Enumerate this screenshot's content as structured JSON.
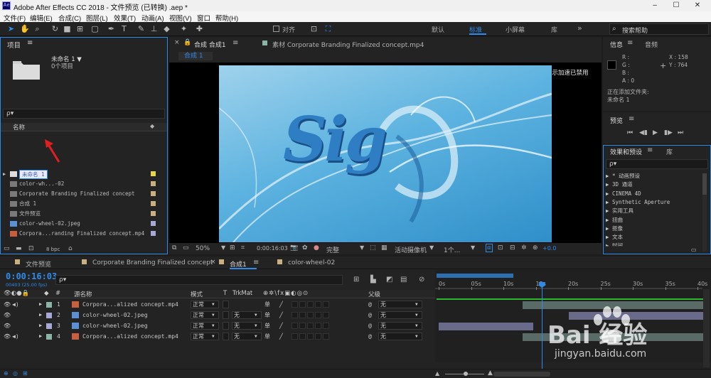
{
  "titlebar": {
    "app_icon": "Ae",
    "title": "Adobe After Effects CC 2018 - 文件预览 (已转换) .aep *",
    "minimize": "–",
    "maximize": "☐",
    "close": "✕"
  },
  "menu": [
    "文件(F)",
    "编辑(E)",
    "合成(C)",
    "图层(L)",
    "效果(T)",
    "动画(A)",
    "视图(V)",
    "窗口",
    "帮助(H)"
  ],
  "toolbar": {
    "snap_label": "对齐",
    "workspaces": [
      "默认",
      "标准",
      "小屏幕",
      "库"
    ],
    "active_workspace": "标准",
    "more": "»",
    "search_help": "搜索帮助"
  },
  "project": {
    "title": "项目",
    "comp_name": "未命名 1 ▼",
    "comp_count": "0个项目",
    "search_placeholder": "ρ▾",
    "col_name": "名称",
    "items": [
      {
        "name": "未命名 1",
        "type": "folder",
        "label_color": "#e4d64a"
      },
      {
        "name": "color-wh...-02",
        "type": "comp",
        "label_color": "#c8b080"
      },
      {
        "name": "Corporate Branding  Finalized concept",
        "type": "comp",
        "label_color": "#c8b080"
      },
      {
        "name": "合成 1",
        "type": "comp",
        "label_color": "#c8b080"
      },
      {
        "name": "文件预览",
        "type": "comp",
        "label_color": "#c8b080"
      },
      {
        "name": "color-wheel-02.jpeg",
        "type": "image",
        "label_color": "#a8a8d8"
      },
      {
        "name": "Corpora...randing  Finalized concept.mp4",
        "type": "video",
        "label_color": "#a8a8d8"
      }
    ],
    "bpc": "8 bpc"
  },
  "composition": {
    "tab_label": "合成 合成1",
    "footage_label": "素材 Corporate Branding  Finalized concept.mp4",
    "sub_tab": "合成 1",
    "accel_notice": "显示加速已禁用",
    "preview_text": "Sig",
    "zoom": "50%",
    "timecode": "0:00:16:03",
    "resolution": "完整",
    "camera": "活动摄像机",
    "views": "1个...",
    "exposure": "+0.0"
  },
  "info": {
    "tab_info": "信息",
    "tab_audio": "音频",
    "r": "R :",
    "g": "G :",
    "b": "B :",
    "a": "A : 0",
    "x": "X : 158",
    "y": "Y : 764",
    "status_line1": "正在添加文件夹:",
    "status_line2": "未命名 1"
  },
  "preview": {
    "title": "预览"
  },
  "effects": {
    "tab_effects": "效果和预设",
    "tab_library": "库",
    "search_placeholder": "ρ▾",
    "items": [
      "▶ * 动画预设",
      "▶ 3D 通道",
      "▶ CINEMA 4D",
      "▶ Synthetic Aperture",
      "▶ 实用工具",
      "▶ 扭曲",
      "▶ 抠像",
      "▶ 文本",
      "▶ 时间"
    ]
  },
  "timeline": {
    "tabs": [
      "文件预览",
      "Corporate Branding  Finalized concept",
      "合成1",
      "color-wheel-02"
    ],
    "active_tab": "合成1",
    "timecode": "0:00:16:03",
    "frames": "00403 (25.00 fps)",
    "search_placeholder": "ρ▾",
    "col_source": "源名称",
    "col_mode": "模式",
    "col_t": "T",
    "col_trkmat": "TrkMat",
    "col_parent": "父级",
    "layers": [
      {
        "num": "1",
        "name": "Corpora...alized concept.mp4",
        "mode": "正常",
        "trkmat": "",
        "parent": "无",
        "label_color": "#8ab4a8",
        "type": "video"
      },
      {
        "num": "2",
        "name": "color-wheel-02.jpeg",
        "mode": "正常",
        "trkmat": "无",
        "parent": "无",
        "label_color": "#a8a8d8",
        "type": "image"
      },
      {
        "num": "3",
        "name": "color-wheel-02.jpeg",
        "mode": "正常",
        "trkmat": "无",
        "parent": "无",
        "label_color": "#a8a8d8",
        "type": "image"
      },
      {
        "num": "4",
        "name": "Corpora...alized concept.mp4",
        "mode": "正常",
        "trkmat": "无",
        "parent": "无",
        "label_color": "#8ab4a8",
        "type": "video"
      }
    ],
    "ruler_ticks": [
      "0s",
      "05s",
      "10s",
      "15s",
      "20s",
      "25s",
      "30s",
      "35s",
      "40s"
    ],
    "playhead_s": 16.12,
    "duration_s": 42
  },
  "watermark": {
    "brand": "Bai 经验",
    "url": "jingyan.baidu.com"
  },
  "colors": {
    "accent": "#2d8ceb",
    "panel": "#232323",
    "bg": "#1d1d1d"
  }
}
